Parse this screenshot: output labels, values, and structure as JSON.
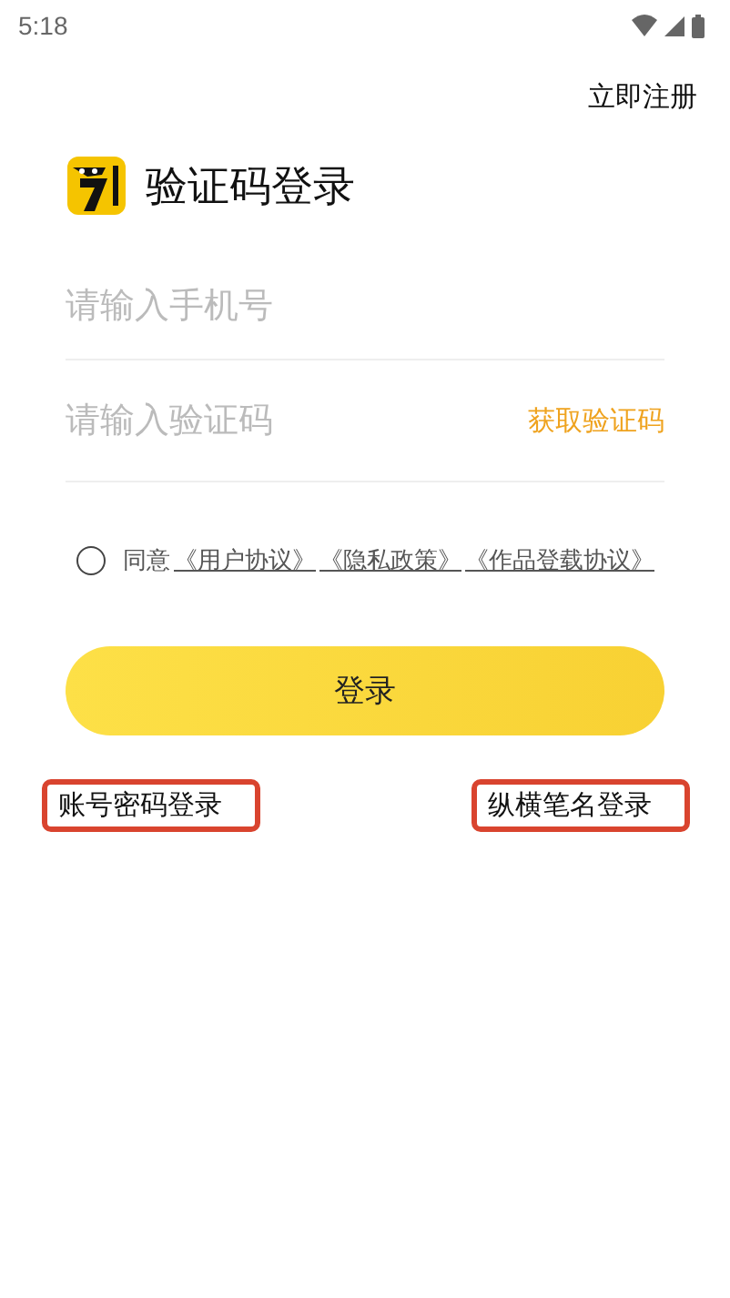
{
  "status_bar": {
    "time": "5:18"
  },
  "header": {
    "register_link": "立即注册"
  },
  "title": "验证码登录",
  "phone_field": {
    "placeholder": "请输入手机号"
  },
  "code_field": {
    "placeholder": "请输入验证码",
    "action": "获取验证码"
  },
  "agreement": {
    "checked": false,
    "prefix": "同意",
    "links": [
      "《用户协议》",
      "《隐私政策》",
      "《作品登载协议》"
    ]
  },
  "login_button": "登录",
  "alt_logins": [
    {
      "label": "账号密码登录",
      "highlighted": true
    },
    {
      "label": "纵横笔名登录",
      "highlighted": true
    }
  ]
}
